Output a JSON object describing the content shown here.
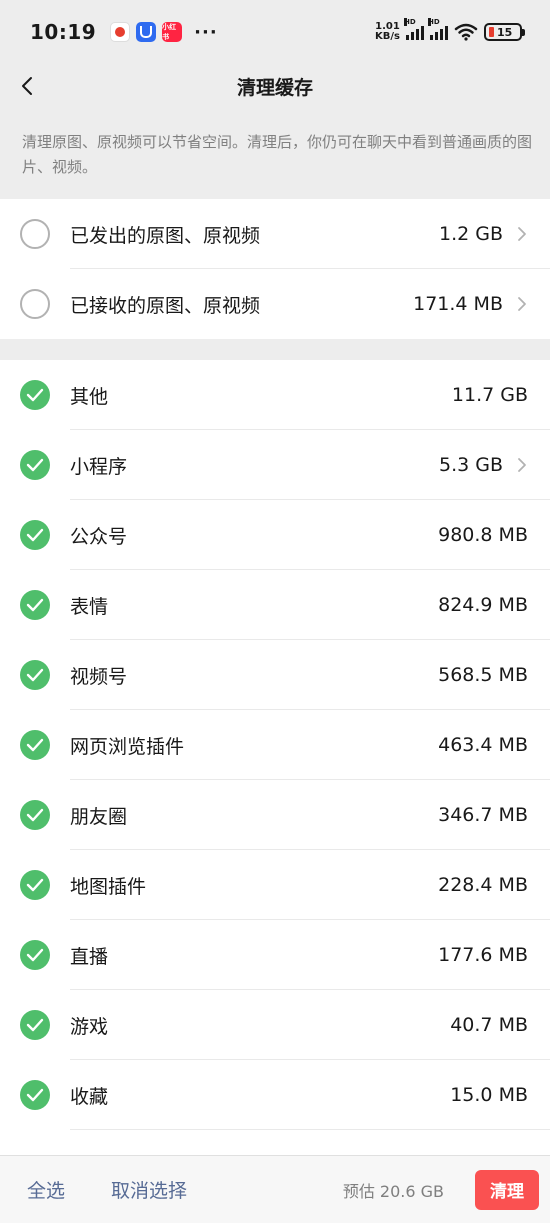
{
  "status_bar": {
    "time": "10:19",
    "app3_label": "小红书",
    "more": "···",
    "net_speed_value": "1.01",
    "net_speed_unit": "KB/s",
    "hd": "HD",
    "battery": "15",
    "battery_color": "#e63d2e"
  },
  "nav": {
    "title": "清理缓存",
    "back_icon": "chevron-left-icon"
  },
  "description": "清理原图、原视频可以节省空间。清理后，你仍可在聊天中看到普通画质的图片、视频。",
  "group_original": [
    {
      "label": "已发出的原图、原视频",
      "size": "1.2 GB",
      "checked": false,
      "has_arrow": true
    },
    {
      "label": "已接收的原图、原视频",
      "size": "171.4 MB",
      "checked": false,
      "has_arrow": true
    }
  ],
  "group_cache": [
    {
      "label": "其他",
      "size": "11.7 GB",
      "checked": true,
      "has_arrow": false
    },
    {
      "label": "小程序",
      "size": "5.3 GB",
      "checked": true,
      "has_arrow": true
    },
    {
      "label": "公众号",
      "size": "980.8 MB",
      "checked": true,
      "has_arrow": false
    },
    {
      "label": "表情",
      "size": "824.9 MB",
      "checked": true,
      "has_arrow": false
    },
    {
      "label": "视频号",
      "size": "568.5 MB",
      "checked": true,
      "has_arrow": false
    },
    {
      "label": "网页浏览插件",
      "size": "463.4 MB",
      "checked": true,
      "has_arrow": false
    },
    {
      "label": "朋友圈",
      "size": "346.7 MB",
      "checked": true,
      "has_arrow": false
    },
    {
      "label": "地图插件",
      "size": "228.4 MB",
      "checked": true,
      "has_arrow": false
    },
    {
      "label": "直播",
      "size": "177.6 MB",
      "checked": true,
      "has_arrow": false
    },
    {
      "label": "游戏",
      "size": "40.7 MB",
      "checked": true,
      "has_arrow": false
    },
    {
      "label": "收藏",
      "size": "15.0 MB",
      "checked": true,
      "has_arrow": false
    }
  ],
  "bottom_bar": {
    "select_all": "全选",
    "deselect": "取消选择",
    "estimate": "预估 20.6 GB",
    "clean": "清理"
  },
  "colors": {
    "check_on": "#4fbe6b",
    "link": "#576b95",
    "danger": "#fa5151"
  }
}
